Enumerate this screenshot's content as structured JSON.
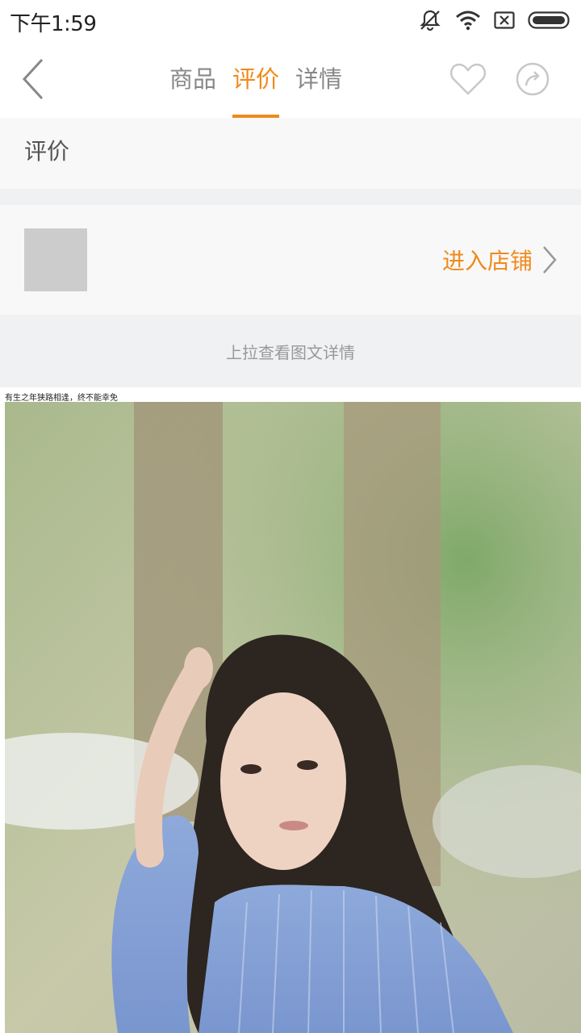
{
  "status_bar": {
    "time": "下午1:59",
    "icons": [
      "mute-icon",
      "wifi-icon",
      "sim-x-icon",
      "battery-icon"
    ]
  },
  "nav": {
    "tabs": [
      {
        "label": "商品",
        "active": false
      },
      {
        "label": "评价",
        "active": true
      },
      {
        "label": "详情",
        "active": false
      }
    ],
    "accent_color": "#f08a1c"
  },
  "review_section": {
    "title": "评价"
  },
  "shop": {
    "enter_label": "进入店铺"
  },
  "pull_hint": "上拉查看图文详情",
  "detail": {
    "caption": "有生之年狭路相逢，终不能幸免"
  }
}
